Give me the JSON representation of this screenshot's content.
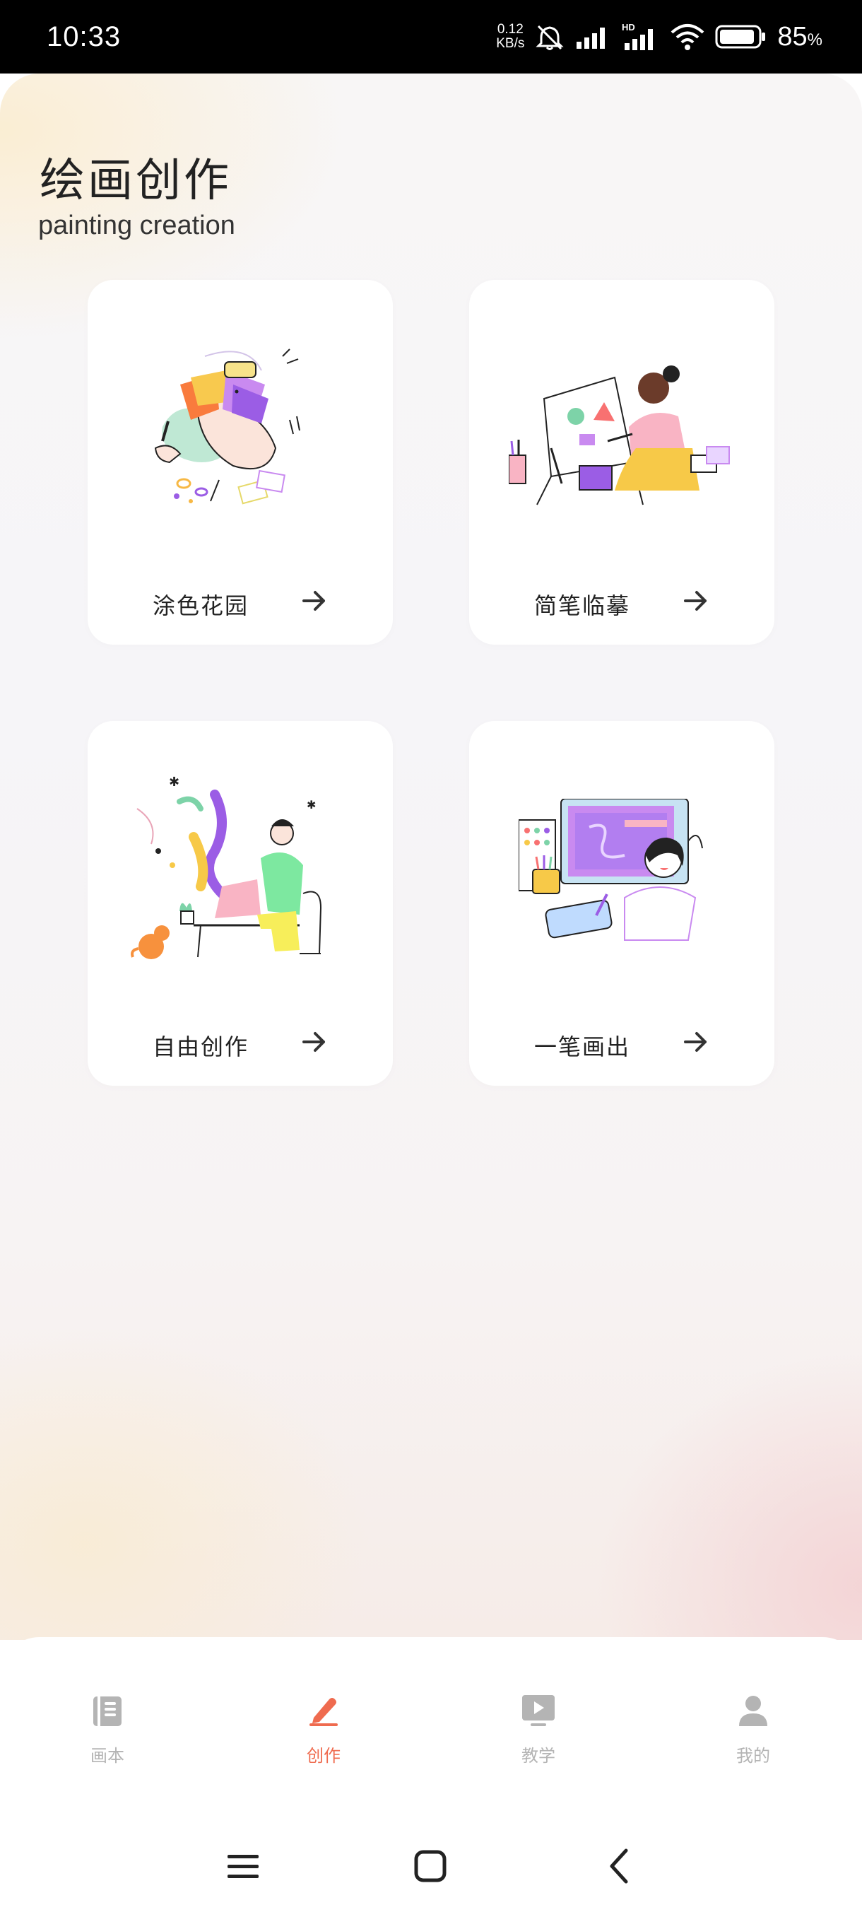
{
  "status_bar": {
    "time": "10:33",
    "net_speed_value": "0.12",
    "net_speed_unit": "KB/s",
    "signal_label": "HD",
    "battery_percent": "85",
    "battery_percent_sign": "%",
    "icons": [
      "mute-icon",
      "signal-icon",
      "hd-signal-icon",
      "wifi-icon",
      "battery-icon"
    ]
  },
  "header": {
    "title": "绘画创作",
    "subtitle": "painting creation"
  },
  "cards": [
    {
      "label": "涂色花园",
      "illustration": "coloring-illustration"
    },
    {
      "label": "简笔临摹",
      "illustration": "easel-painting-illustration"
    },
    {
      "label": "自由创作",
      "illustration": "free-drawing-illustration"
    },
    {
      "label": "一笔画出",
      "illustration": "tablet-drawing-illustration"
    }
  ],
  "bottom_nav": {
    "items": [
      {
        "label": "画本",
        "icon": "book-icon",
        "active": false
      },
      {
        "label": "创作",
        "icon": "pencil-icon",
        "active": true
      },
      {
        "label": "教学",
        "icon": "video-play-icon",
        "active": false
      },
      {
        "label": "我的",
        "icon": "person-icon",
        "active": false
      }
    ],
    "active_color": "#ef6b4f",
    "inactive_color": "#b4b4b4"
  },
  "system_nav": {
    "icons": [
      "menu-icon",
      "home-icon",
      "back-icon"
    ]
  }
}
